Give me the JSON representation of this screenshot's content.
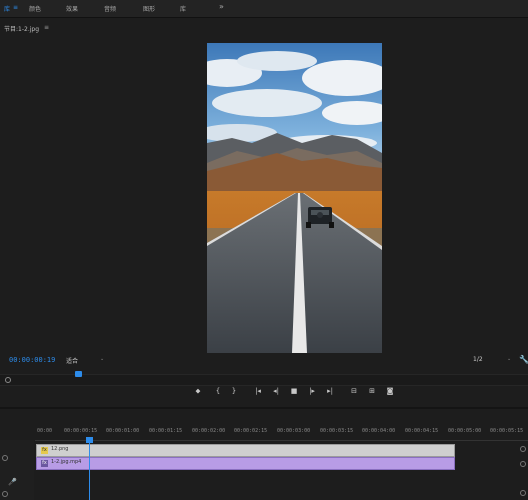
{
  "menubar": {
    "items": [
      {
        "label": "库",
        "active": true
      },
      {
        "label": "≡",
        "active": true
      },
      {
        "label": "颜色"
      },
      {
        "label": "效果"
      },
      {
        "label": "音频"
      },
      {
        "label": "图形"
      },
      {
        "label": "库"
      },
      {
        "label": "»"
      }
    ]
  },
  "monitor": {
    "title": "节目:1-2.jpg",
    "menu_icon": "≡",
    "timecode": "00:00:00:19",
    "fit": "适合",
    "resolution": "1/2",
    "wrench_icon": "wrench-icon"
  },
  "transport": {
    "buttons": [
      {
        "name": "marker-icon",
        "glyph": "⬥"
      },
      {
        "name": "mark-in-icon",
        "glyph": "{"
      },
      {
        "name": "mark-out-icon",
        "glyph": "}"
      },
      {
        "name": "go-to-in-icon",
        "glyph": "|◂"
      },
      {
        "name": "step-back-icon",
        "glyph": "◂|"
      },
      {
        "name": "stop-icon",
        "glyph": "■"
      },
      {
        "name": "step-forward-icon",
        "glyph": "|▸"
      },
      {
        "name": "go-to-out-icon",
        "glyph": "▸|"
      },
      {
        "name": "lift-icon",
        "glyph": "⊟"
      },
      {
        "name": "extract-icon",
        "glyph": "⊞"
      },
      {
        "name": "export-frame-icon",
        "glyph": "◙"
      }
    ]
  },
  "timeline": {
    "ruler": [
      "00:00",
      "00:00:00:15",
      "00:00:01:00",
      "00:00:01:15",
      "00:00:02:00",
      "00:00:02:15",
      "00:00:03:00",
      "00:00:03:15",
      "00:00:04:00",
      "00:00:04:15",
      "00:00:05:00",
      "00:00:05:15"
    ],
    "clip_v2": "12.png",
    "clip_v1": "1-2.jpg.mp4",
    "playhead_fraction": 0.12
  },
  "colors": {
    "accent": "#2d8ceb",
    "clip_image": "#cfcfcf",
    "clip_video": "#b89ce6",
    "background": "#1d1d1d"
  }
}
